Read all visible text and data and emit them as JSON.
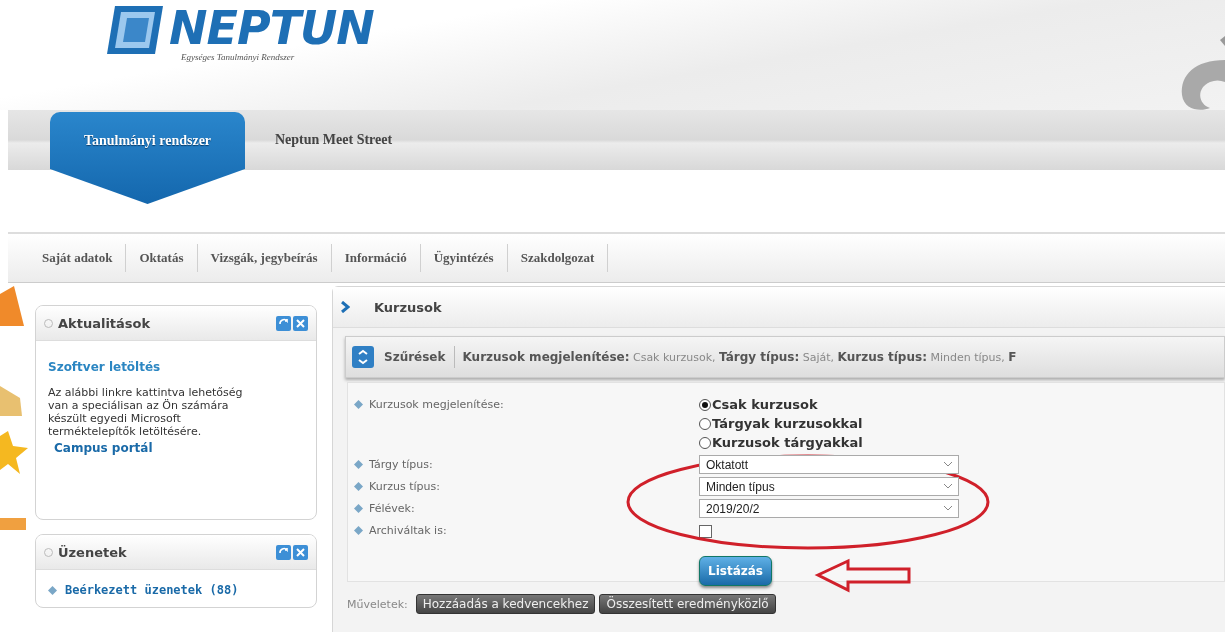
{
  "logo": {
    "name": "NEPTUN",
    "tagline": "Egységes Tanulmányi Rendszer"
  },
  "header_tabs": [
    {
      "label": "Tanulmányi rendszer",
      "selected": true
    },
    {
      "label": "Neptun Meet Street",
      "selected": false
    }
  ],
  "menu": [
    "Saját adatok",
    "Oktatás",
    "Vizsgák, jegybeírás",
    "Információ",
    "Ügyintézés",
    "Szakdolgozat"
  ],
  "panels": [
    {
      "title": "Aktualitások",
      "items": [
        {
          "kind": "heading",
          "text": "Szoftver letöltés"
        },
        {
          "kind": "paragraph",
          "text": "Az alábbi linkre kattintva lehetőség van a speciálisan az Ön számára készült egyedi Microsoft terméktelepítők letöltésére."
        },
        {
          "kind": "link",
          "text": "Campus portál"
        }
      ]
    },
    {
      "title": "Üzenetek",
      "items": [
        {
          "kind": "bullet-link",
          "text": "Beérkezett üzenetek (88)"
        }
      ]
    }
  ],
  "main": {
    "title": "Kurzusok",
    "filter_bar": {
      "label": "Szűrések",
      "summary": [
        {
          "kind": "key",
          "text": "Kurzusok megjelenítése:"
        },
        {
          "kind": "value",
          "text": "Csak kurzusok,"
        },
        {
          "kind": "key",
          "text": "Tárgy típus:"
        },
        {
          "kind": "value",
          "text": "Saját,"
        },
        {
          "kind": "key",
          "text": "Kurzus típus:"
        },
        {
          "kind": "value",
          "text": "Minden típus,"
        },
        {
          "kind": "key",
          "text": "F"
        }
      ]
    },
    "fields": [
      {
        "kind": "radio",
        "label": "Kurzusok megjelenítése:",
        "options": [
          {
            "label": "Csak kurzusok",
            "selected": true
          },
          {
            "label": "Tárgyak kurzusokkal",
            "selected": false
          },
          {
            "label": "Kurzusok tárgyakkal",
            "selected": false
          }
        ]
      },
      {
        "kind": "select",
        "label": "Tárgy típus:",
        "value": "Oktatott"
      },
      {
        "kind": "select",
        "label": "Kurzus típus:",
        "value": "Minden típus"
      },
      {
        "kind": "select",
        "label": "Félévek:",
        "value": "2019/20/2"
      },
      {
        "kind": "checkbox",
        "label": "Archiváltak is:",
        "checked": false
      }
    ],
    "submit": "Listázás"
  },
  "actions": {
    "label": "Műveletek:",
    "buttons": [
      "Hozzáadás a kedvencekhez",
      "Összesített eredményközlő"
    ]
  }
}
